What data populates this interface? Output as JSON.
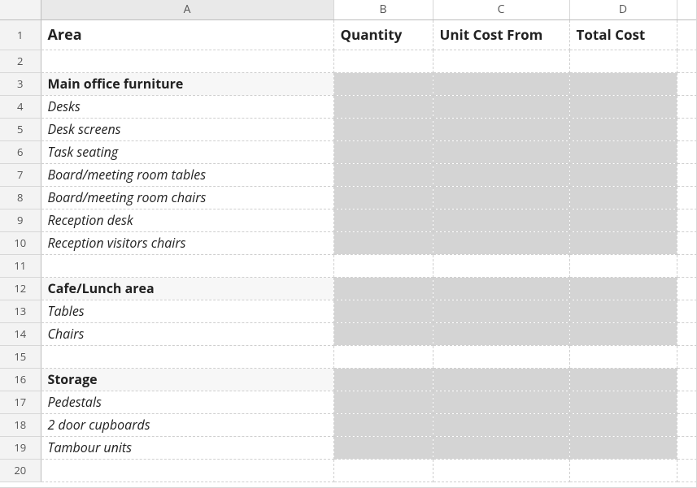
{
  "columns": {
    "A": "A",
    "B": "B",
    "C": "C",
    "D": "D"
  },
  "headers": {
    "A": "Area",
    "B": "Quantity",
    "C": "Unit Cost From",
    "D": "Total Cost"
  },
  "rows": [
    {
      "n": 1,
      "type": "header"
    },
    {
      "n": 2,
      "type": "blank"
    },
    {
      "n": 3,
      "type": "section",
      "label": "Main office furniture"
    },
    {
      "n": 4,
      "type": "item",
      "label": "Desks"
    },
    {
      "n": 5,
      "type": "item",
      "label": "Desk screens"
    },
    {
      "n": 6,
      "type": "item",
      "label": "Task seating"
    },
    {
      "n": 7,
      "type": "item",
      "label": "Board/meeting room tables"
    },
    {
      "n": 8,
      "type": "item",
      "label": "Board/meeting room chairs"
    },
    {
      "n": 9,
      "type": "item",
      "label": "Reception desk"
    },
    {
      "n": 10,
      "type": "item",
      "label": "Reception visitors chairs"
    },
    {
      "n": 11,
      "type": "blank"
    },
    {
      "n": 12,
      "type": "section",
      "label": "Cafe/Lunch area"
    },
    {
      "n": 13,
      "type": "item",
      "label": "Tables"
    },
    {
      "n": 14,
      "type": "item",
      "label": "Chairs"
    },
    {
      "n": 15,
      "type": "blank"
    },
    {
      "n": 16,
      "type": "section",
      "label": "Storage"
    },
    {
      "n": 17,
      "type": "item",
      "label": "Pedestals"
    },
    {
      "n": 18,
      "type": "item",
      "label": "2 door cupboards"
    },
    {
      "n": 19,
      "type": "item",
      "label": "Tambour units"
    },
    {
      "n": 20,
      "type": "blank"
    }
  ],
  "chart_data": {
    "type": "table",
    "title": "",
    "columns": [
      "Area",
      "Quantity",
      "Unit Cost From",
      "Total Cost"
    ],
    "rows": [
      [
        "Main office furniture",
        "",
        "",
        ""
      ],
      [
        "Desks",
        "",
        "",
        ""
      ],
      [
        "Desk screens",
        "",
        "",
        ""
      ],
      [
        "Task seating",
        "",
        "",
        ""
      ],
      [
        "Board/meeting room tables",
        "",
        "",
        ""
      ],
      [
        "Board/meeting room chairs",
        "",
        "",
        ""
      ],
      [
        "Reception desk",
        "",
        "",
        ""
      ],
      [
        "Reception visitors chairs",
        "",
        "",
        ""
      ],
      [
        "Cafe/Lunch area",
        "",
        "",
        ""
      ],
      [
        "Tables",
        "",
        "",
        ""
      ],
      [
        "Chairs",
        "",
        "",
        ""
      ],
      [
        "Storage",
        "",
        "",
        ""
      ],
      [
        "Pedestals",
        "",
        "",
        ""
      ],
      [
        "2 door cupboards",
        "",
        "",
        ""
      ],
      [
        "Tambour units",
        "",
        "",
        ""
      ]
    ]
  }
}
